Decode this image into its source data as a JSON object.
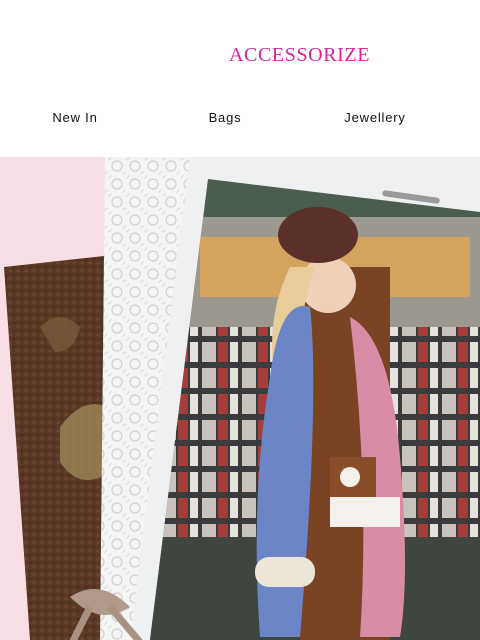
{
  "brand": {
    "name": "ACCESSORIZE",
    "color": "#d6249f"
  },
  "nav": {
    "items": [
      {
        "label": "New In"
      },
      {
        "label": "Bags"
      },
      {
        "label": "Jewellery"
      }
    ]
  },
  "hero": {
    "description_icon": "photo-collage",
    "colors": {
      "background": "#f7dfe6",
      "frame": "#eef0f1",
      "lace": "#f6f6f6",
      "tapestry": "#5a3826"
    }
  }
}
